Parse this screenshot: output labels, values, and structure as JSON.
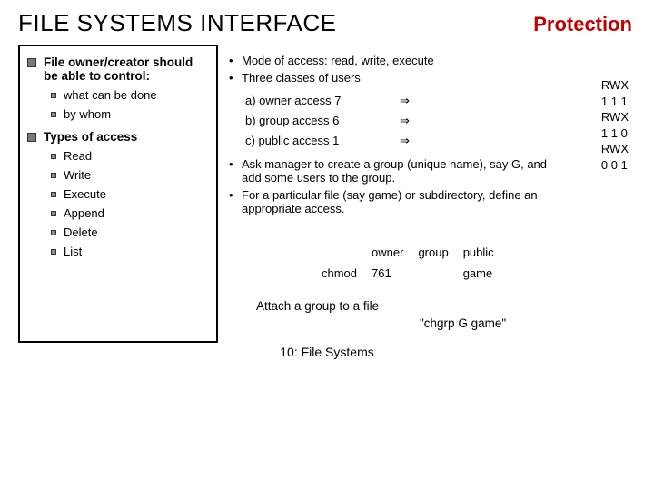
{
  "title": "FILE SYSTEMS INTERFACE",
  "section": "Protection",
  "left": {
    "h1": "File owner/creator should be able to control:",
    "sub1a": "what can be done",
    "sub1b": "by whom",
    "h2": "Types of access",
    "types": {
      "a": "Read",
      "b": "Write",
      "c": "Execute",
      "d": "Append",
      "e": "Delete",
      "f": "List"
    }
  },
  "right": {
    "b1": "Mode of access:  read, write, execute",
    "b2": "Three classes of users",
    "access": {
      "a_label": "a) owner access",
      "a_num": "7",
      "a_arrow": "⇒",
      "b_label": "b) group access",
      "b_num": "6",
      "b_arrow": "⇒",
      "c_label": "c) public access",
      "c_num": "1",
      "c_arrow": "⇒"
    },
    "b3": "Ask manager to create a group (unique name), say G, and add some users to the group.",
    "b4": "For a particular file (say game) or subdirectory, define an appropriate access."
  },
  "rwx": {
    "h": "RWX",
    "a": "1 1 1",
    "b": "1 1 0",
    "c": "0 0 1"
  },
  "perm": {
    "h_owner": "owner",
    "h_group": "group",
    "h_public": "public",
    "cmd": "chmod",
    "mode": "761",
    "file": "game"
  },
  "attach": "Attach a group to a file",
  "chgrp": "\"chgrp      G      game\"",
  "footer": "10: File Systems"
}
